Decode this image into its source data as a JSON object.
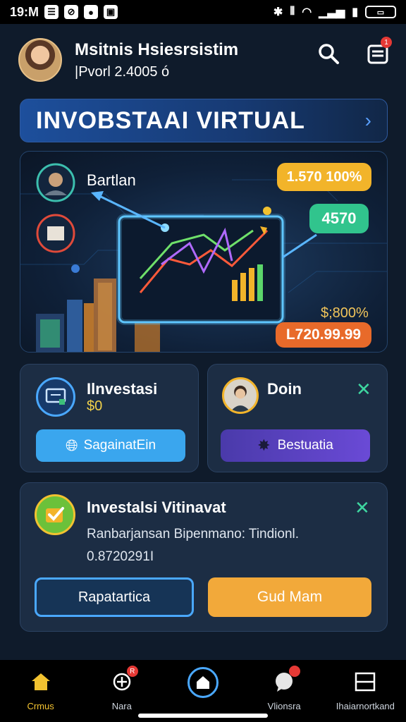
{
  "status_bar": {
    "time": "19:M",
    "battery": ""
  },
  "header": {
    "user_name": "Msitnis Hsiesrsistim",
    "user_sub": "|Pvorl 2.4005 ó",
    "notification_badge": "1"
  },
  "banner": {
    "title": "INVOBSTAAI VIRTUAL"
  },
  "hero": {
    "label": "Bartlan",
    "pill_top": "1.570 100%",
    "pill_mid": "4570",
    "percent": "$;800%",
    "pill_bottom": "L720.99.99"
  },
  "card_invest": {
    "title": "Ilnvestasi",
    "amount": "$0",
    "button_label": "SagainatEin"
  },
  "card_don": {
    "title": "Doin",
    "button_label": "Bestuatia"
  },
  "card_virtual": {
    "title": "Investalsi Vitinavat",
    "description": "Ranbarjansan Bipenmano: Tindionl.",
    "amount": "0.8720291I",
    "button_left": "Rapatartica",
    "button_right": "Gud Mam"
  },
  "bottom_nav": {
    "items": [
      {
        "label": "Crmus",
        "icon": "home-icon"
      },
      {
        "label": "Nara",
        "icon": "add-target-icon",
        "badge": "R"
      },
      {
        "label": "",
        "icon": "center-home-icon"
      },
      {
        "label": "Vlionsra",
        "icon": "chat-icon",
        "badge": ""
      },
      {
        "label": "Ihaiarnortkand",
        "icon": "window-icon"
      }
    ]
  },
  "colors": {
    "background": "#0f1b2b",
    "accent_gold": "#f2c230",
    "accent_green": "#31c48d",
    "accent_blue": "#1d4f9c",
    "accent_orange": "#e86a2a",
    "accent_purple": "#5a3fc0"
  }
}
